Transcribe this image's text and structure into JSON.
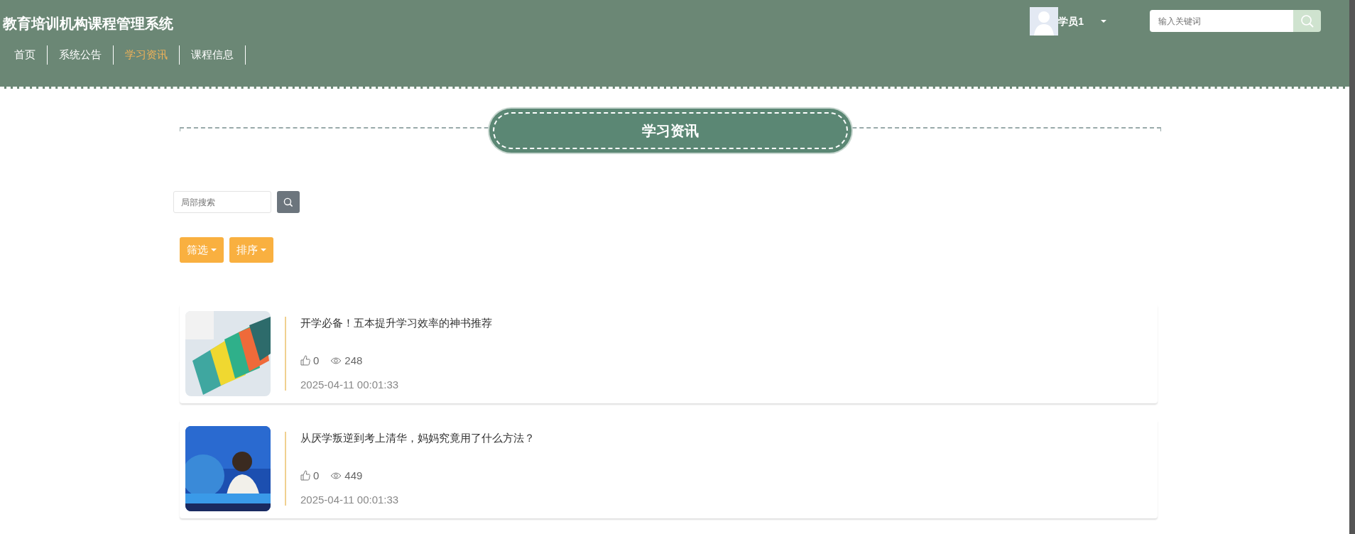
{
  "header": {
    "title": "教育培训机构课程管理系统",
    "nav": [
      {
        "label": "首页",
        "selected": false
      },
      {
        "label": "系统公告",
        "selected": false
      },
      {
        "label": "学习资讯",
        "selected": true
      },
      {
        "label": "课程信息",
        "selected": false
      }
    ],
    "user": {
      "name": "学员1"
    },
    "search": {
      "placeholder": "输入关键词"
    }
  },
  "section_title": "学习资讯",
  "local_search": {
    "placeholder": "局部搜索"
  },
  "filters": [
    "筛选",
    "排序"
  ],
  "articles": [
    {
      "title": "开学必备！五本提升学习效率的神书推荐",
      "likes": "0",
      "views": "248",
      "date": "2025-04-11 00:01:33"
    },
    {
      "title": "从厌学叛逆到考上清华，妈妈究竟用了什么方法？",
      "likes": "0",
      "views": "449",
      "date": "2025-04-11 00:01:33"
    }
  ]
}
